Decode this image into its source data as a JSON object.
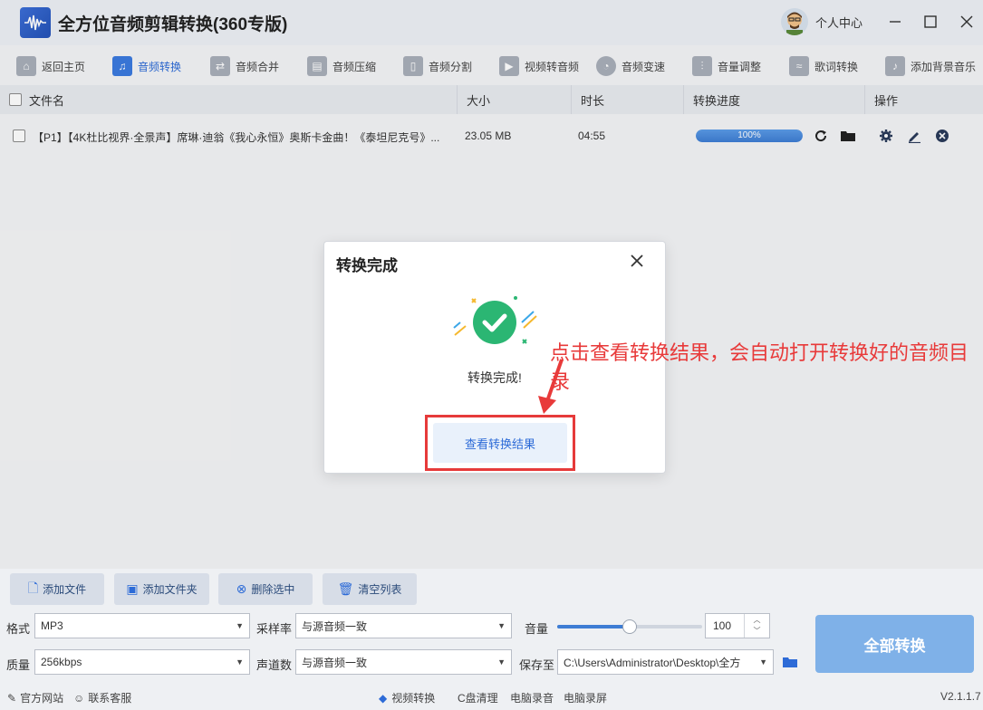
{
  "window": {
    "title": "全方位音频剪辑转换(360专版)",
    "user_label": "个人中心"
  },
  "toolbar": {
    "items": [
      {
        "label": "返回主页",
        "icon": "home-icon"
      },
      {
        "label": "音频转换",
        "icon": "music-note-icon",
        "active": true
      },
      {
        "label": "音频合并",
        "icon": "merge-icon"
      },
      {
        "label": "音频压缩",
        "icon": "compress-icon"
      },
      {
        "label": "音频分割",
        "icon": "split-icon"
      },
      {
        "label": "视频转音频",
        "icon": "video-icon"
      },
      {
        "label": "音频变速",
        "icon": "speed-icon"
      },
      {
        "label": "音量调整",
        "icon": "volume-adjust-icon"
      },
      {
        "label": "歌词转换",
        "icon": "lyrics-icon"
      },
      {
        "label": "添加背景音乐",
        "icon": "bg-music-icon"
      }
    ]
  },
  "table": {
    "headers": {
      "name": "文件名",
      "size": "大小",
      "duration": "时长",
      "progress": "转换进度",
      "actions": "操作"
    },
    "rows": [
      {
        "name": "【P1】【4K杜比视界·全景声】席琳·迪翁《我心永恒》奥斯卡金曲！《泰坦尼克号》...",
        "size": "23.05 MB",
        "duration": "04:55",
        "progress_text": "100%",
        "progress": 1.0
      }
    ]
  },
  "modal": {
    "title": "转换完成",
    "message": "转换完成!",
    "button": "查看转换结果"
  },
  "annotation": {
    "text": "点击查看转换结果，会自动打开转换好的音频目录"
  },
  "actions": {
    "add_file": "添加文件",
    "add_folder": "添加文件夹",
    "delete_selected": "删除选中",
    "clear_list": "清空列表"
  },
  "settings": {
    "format_label": "格式",
    "format_value": "MP3",
    "sample_rate_label": "采样率",
    "sample_rate_value": "与源音频一致",
    "volume_label": "音量",
    "volume_value": "100",
    "volume_level": 0.5,
    "quality_label": "质量",
    "quality_value": "256kbps",
    "channels_label": "声道数",
    "channels_value": "与源音频一致",
    "save_label": "保存至",
    "save_path": "C:\\Users\\Administrator\\Desktop\\全方",
    "convert_all": "全部转换"
  },
  "statusbar": {
    "official_site": "官方网站",
    "support": "联系客服",
    "video_convert": "视频转换",
    "c_clean": "C盘清理",
    "pc_record_audio": "电脑录音",
    "pc_record_screen": "电脑录屏",
    "version": "V2.1.1.7"
  },
  "colors": {
    "accent": "#2d6bd7",
    "annotation": "#e83a3a",
    "success": "#2bb673"
  }
}
